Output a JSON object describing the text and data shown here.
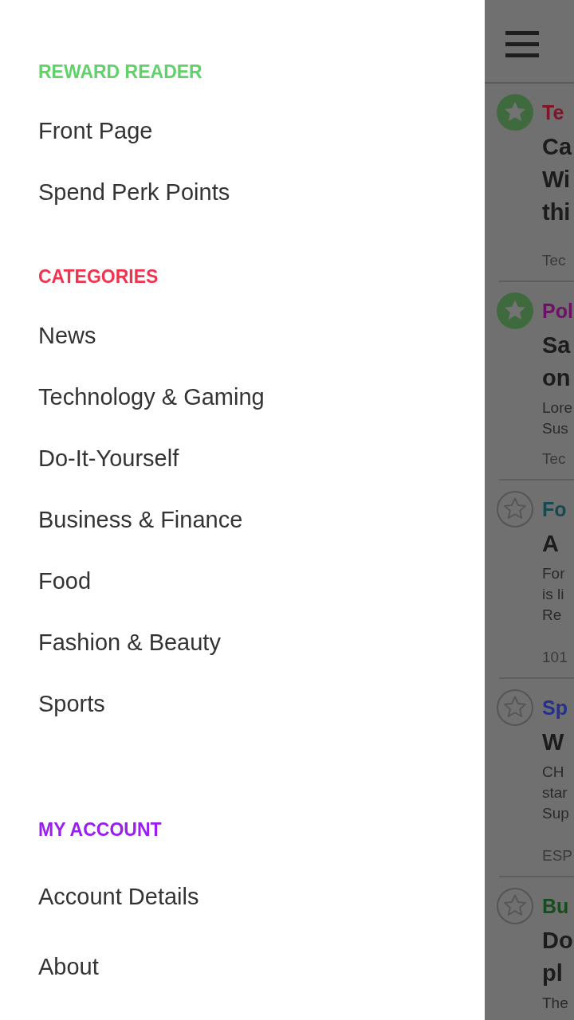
{
  "drawer": {
    "sections": [
      {
        "heading": "REWARD READER",
        "color": "#61d26a",
        "items": [
          "Front Page",
          "Spend Perk Points"
        ]
      },
      {
        "heading": "CATEGORIES",
        "color": "#ef3450",
        "items": [
          "News",
          "Technology & Gaming",
          "Do-It-Yourself",
          "Business & Finance",
          "Food",
          "Fashion & Beauty",
          "Sports"
        ]
      },
      {
        "heading": "MY ACCOUNT",
        "color": "#9a1ef0",
        "items": [
          "Account Details",
          "About"
        ]
      }
    ]
  },
  "feed": {
    "articles": [
      {
        "starred": true,
        "category": "Te",
        "color": "#7e1628",
        "headline": [
          "Ca",
          "Wi",
          "thi"
        ],
        "source": "Tec"
      },
      {
        "starred": true,
        "category": "Pol",
        "color": "#6c1264",
        "headline": [
          "Sa",
          "on"
        ],
        "summary": [
          "Lore",
          "Sus"
        ],
        "source": "Tec"
      },
      {
        "starred": false,
        "category": "Fo",
        "color": "#164a50",
        "headline": [
          "A"
        ],
        "summary": [
          "For",
          "is li",
          "Re"
        ],
        "source": "101"
      },
      {
        "starred": false,
        "category": "Sp",
        "color": "#24318a",
        "headline": [
          "W"
        ],
        "summary": [
          "CH",
          "star",
          "Sup"
        ],
        "source": "ESP"
      },
      {
        "starred": false,
        "category": "Bu",
        "color": "#164d1e",
        "headline": [
          "Do",
          "pl"
        ],
        "summary": [
          "The"
        ]
      }
    ]
  }
}
